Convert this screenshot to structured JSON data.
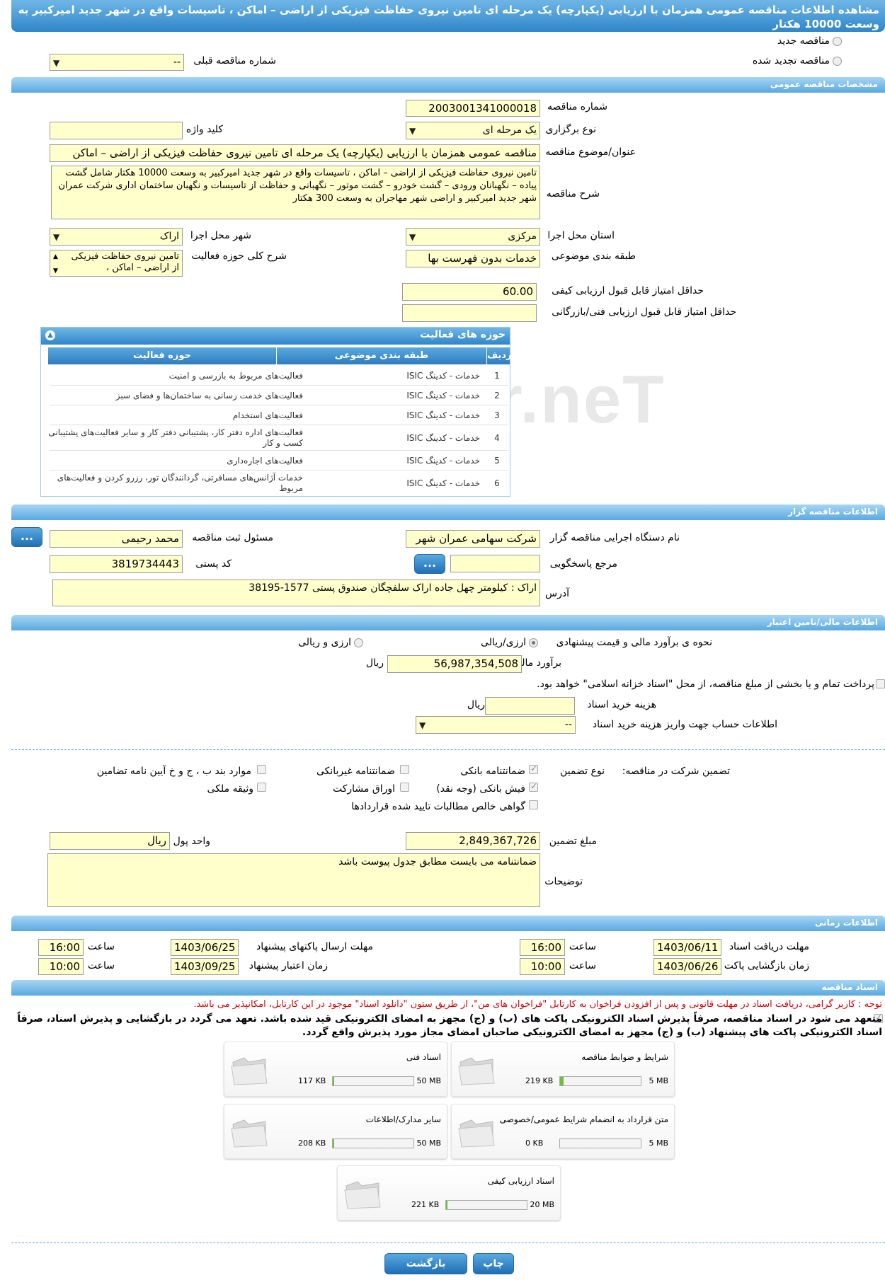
{
  "page_title": "مشاهده اطلاعات مناقصه عمومی همزمان با ارزیابی (یکپارچه) یک مرحله ای تامین نیروی حفاظت فیزیکی از اراضی – اماکن ، تاسیسات واقع در شهر جدید امیرکبیر به وسعت 10000 هکتار",
  "tender_type": {
    "new_label": "مناقصه جدید",
    "renewed_label": "مناقصه تجدید شده",
    "prev_number_label": "شماره مناقصه قبلی",
    "prev_number_value": "--"
  },
  "general": {
    "section_title": "مشخصات مناقصه عمومی",
    "number_label": "شماره مناقصه",
    "number_value": "2003001341000018",
    "type_label": "نوع برگزاری",
    "type_value": "یک مرحله ای",
    "keyword_label": "کلید واژه",
    "keyword_value": "",
    "subject_label": "عنوان/موضوع مناقصه",
    "subject_value": "مناقصه عمومی همزمان با ارزیابی (یکپارچه) یک مرحله ای تامین نیروی حفاظت فیزیکی از اراضی – اماکن",
    "description_label": "شرح مناقصه",
    "description_value": "تامین نیروی حفاظت فیزیکی از اراضی – اماکن ، تاسیسات واقع در شهر جدید امیرکبیر به وسعت 10000 هکتار شامل گشت پیاده – نگهبانان ورودی – گشت خودرو – گشت موتور – نگهبانی و حفاظت از تاسیسات و نگهبان ساختمان اداری شرکت عمران شهر جدید امیرکبیر و اراضی شهر مهاجران به وسعت 300 هکتار",
    "province_label": "استان محل اجرا",
    "province_value": "مرکزی",
    "city_label": "شهر محل اجرا",
    "city_value": "اراک",
    "category_label": "طبقه بندی موضوعی",
    "category_value": "خدمات بدون فهرست بها",
    "activity_desc_label": "شرح کلی حوزه فعالیت",
    "activity_desc_value": "تامین نیروی حفاظت فیزیکی از اراضی – اماکن ،",
    "min_quality_label": "حداقل امتیاز قابل قبول ارزیابی کیفی",
    "min_quality_value": "60.00",
    "min_tech_label": "حداقل امتیاز قابل قبول ارزیابی فنی/بازرگانی",
    "min_tech_value": ""
  },
  "activities": {
    "title": "حوزه های فعالیت",
    "col_row": "ردیف",
    "col_category": "طبقه بندی موضوعی",
    "col_activity": "حوزه فعالیت",
    "rows": [
      {
        "num": "1",
        "category": "خدمات - کدینگ ISIC",
        "activity": "فعالیت‌های مربوط به بازرسی و امنیت"
      },
      {
        "num": "2",
        "category": "خدمات - کدینگ ISIC",
        "activity": "فعالیت‌های خدمت رسانی به ساختمان‌ها و فضای سبز"
      },
      {
        "num": "3",
        "category": "خدمات - کدینگ ISIC",
        "activity": "فعالیت‌های استخدام"
      },
      {
        "num": "4",
        "category": "خدمات - کدینگ ISIC",
        "activity": "فعالیت‌های اداره دفتر کار، پشتیبانی دفتر کار و سایر فعالیت‌های پشتیبانی کسب و کار"
      },
      {
        "num": "5",
        "category": "خدمات - کدینگ ISIC",
        "activity": "فعالیت‌های اجاره‌داری"
      },
      {
        "num": "6",
        "category": "خدمات - کدینگ ISIC",
        "activity": "خدمات آژانس‌های مسافرتی، گردانندگان تور، رزرو کردن و فعالیت‌های مربوط"
      }
    ]
  },
  "organizer": {
    "section_title": "اطلاعات مناقصه گزار",
    "org_label": "نام دستگاه اجرایی مناقصه گزار",
    "org_value": "شرکت سهامی عمران شهر",
    "responsible_label": "مسئول ثبت مناقصه",
    "responsible_value": "محمد رحیمی",
    "ref_label": "مرجع پاسخگویی",
    "ref_value": "",
    "postal_label": "کد پستی",
    "postal_value": "3819734443",
    "address_label": "آدرس",
    "address_value": "اراک : کیلومتر چهل جاده اراک سلفچگان  صندوق پستی 1577-38195",
    "dots": "..."
  },
  "finance": {
    "section_title": "اطلاعات مالی/تامین اعتبار",
    "estimate_method_label": "نحوه ی برآورد مالی و قیمت پیشنهادی",
    "opt_rial": "ارزی/ریالی",
    "opt_fx": "ارزی و ریالی",
    "estimate_label": "برآورد مالی",
    "estimate_value": "56,987,354,508",
    "rial": "ریال",
    "treasury_text": "پرداخت تمام و یا بخشی از مبلغ مناقصه، از محل \"اسناد خزانه اسلامی\" خواهد بود.",
    "doc_fee_label": "هزینه خرید اسناد",
    "doc_fee_value": "",
    "account_label": "اطلاعات حساب جهت واریز هزینه خرید اسناد",
    "account_value": "--"
  },
  "guarantee": {
    "label": "تضمین شرکت در مناقصه:",
    "type_label": "نوع تضمین",
    "opt_bank": "ضمانتنامه بانکی",
    "opt_nonbank": "ضمانتنامه غیربانکی",
    "opt_clauses": "موارد بند ب ، ج و خ آیین نامه تضامین",
    "opt_cash": "فیش بانکی (وجه نقد)",
    "opt_bonds": "اوراق مشارکت",
    "opt_property": "وثیقه ملکی",
    "opt_receivable": "گواهی خالص مطالبات تایید شده قراردادها",
    "amount_label": "مبلغ تضمین",
    "amount_value": "2,849,367,726",
    "currency_label": "واحد پول",
    "currency_value": "ریال",
    "notes_label": "توضیحات",
    "notes_value": "ضمانتنامه می بایست مطابق جدول پیوست باشد"
  },
  "timing": {
    "section_title": "اطلاعات زمانی",
    "doc_deadline_label": "مهلت دریافت اسناد",
    "doc_deadline_date": "1403/06/11",
    "doc_deadline_time": "16:00",
    "submit_deadline_label": "مهلت ارسال پاکتهای پیشنهاد",
    "submit_deadline_date": "1403/06/25",
    "submit_deadline_time": "16:00",
    "opening_label": "زمان بازگشایی پاکت ها",
    "opening_date": "1403/06/26",
    "opening_time": "10:00",
    "validity_label": "زمان اعتبار پیشنهاد",
    "validity_date": "1403/09/25",
    "validity_time": "10:00",
    "time_label": "ساعت"
  },
  "documents": {
    "section_title": "اسناد مناقصه",
    "notice_red": "توجه : کاربر گرامی، دریافت اسناد در مهلت قانونی و پس از افزودن فراخوان به کارتابل \"فراخوان های من\"، از طریق ستون \"دانلود اسناد\" موجود در این کارتابل، امکانپذیر می باشد.",
    "notice_bold": "متعهد می شود در اسناد مناقصه، صرفاً پذیرش اسناد الکترونیکی پاکت های (ب) و (ج) مجهز به امضای الکترونیکی قید شده باشد. تعهد می گردد در بازگشایی و پذیرش اسناد، صرفاً اسناد الکترونیکی پاکت های پیشنهاد (ب) و (ج) مجهز به امضای الکترونیکی صاحبان امضای مجاز مورد پذیرش واقع گردد.",
    "files": [
      {
        "title": "شرایط و ضوابط مناقصه",
        "used": "219 KB",
        "max": "5 MB",
        "fill": 0.04
      },
      {
        "title": "اسناد فنی",
        "used": "117 KB",
        "max": "50 MB",
        "fill": 0.002
      },
      {
        "title": "متن قرارداد به انضمام شرایط عمومی/خصوصی",
        "used": "0 KB",
        "max": "5 MB",
        "fill": 0
      },
      {
        "title": "سایر مدارک/اطلاعات",
        "used": "208 KB",
        "max": "50 MB",
        "fill": 0.004
      },
      {
        "title": "اسناد ارزیابی کیفی",
        "used": "221 KB",
        "max": "20 MB",
        "fill": 0.011
      }
    ]
  },
  "actions": {
    "print": "چاپ",
    "back": "بازگشت"
  },
  "watermark": "AriaTender.neT"
}
